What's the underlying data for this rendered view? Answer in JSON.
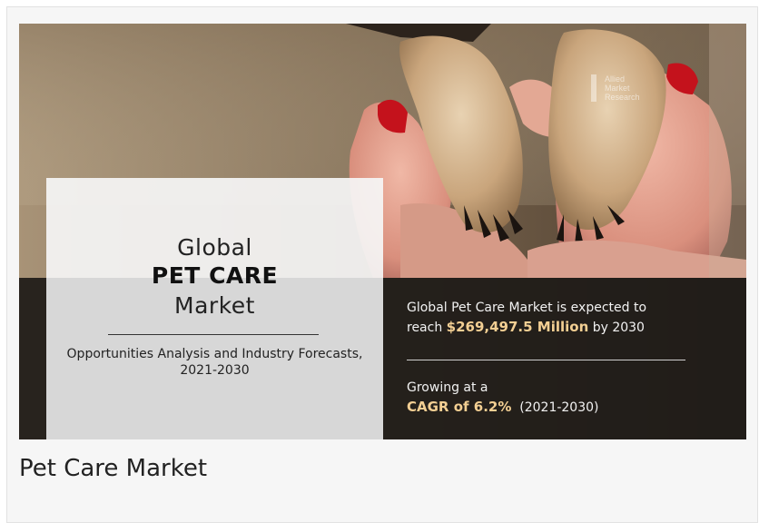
{
  "banner": {
    "watermark": [
      "Allied",
      "Market",
      "Research"
    ],
    "title_line1": "Global",
    "title_line2": "PET CARE",
    "title_line3": "Market",
    "subtitle_line1": "Opportunities Analysis and Industry Forecasts,",
    "subtitle_line2": "2021-2030",
    "stat1_prefix": "Global Pet Care Market is expected to",
    "stat1_reach": "reach ",
    "stat1_value": "$269,497.5 Million",
    "stat1_suffix": " by 2030",
    "stat2_prefix": "Growing at a",
    "stat2_value": "CAGR of 6.2%",
    "stat2_suffix": "  (2021-2030)"
  },
  "caption": "Pet Care Market",
  "colors": {
    "highlight": "#f3cf93",
    "dark_strip": "#1e1b18",
    "card_bg": "#f6f6f6"
  }
}
